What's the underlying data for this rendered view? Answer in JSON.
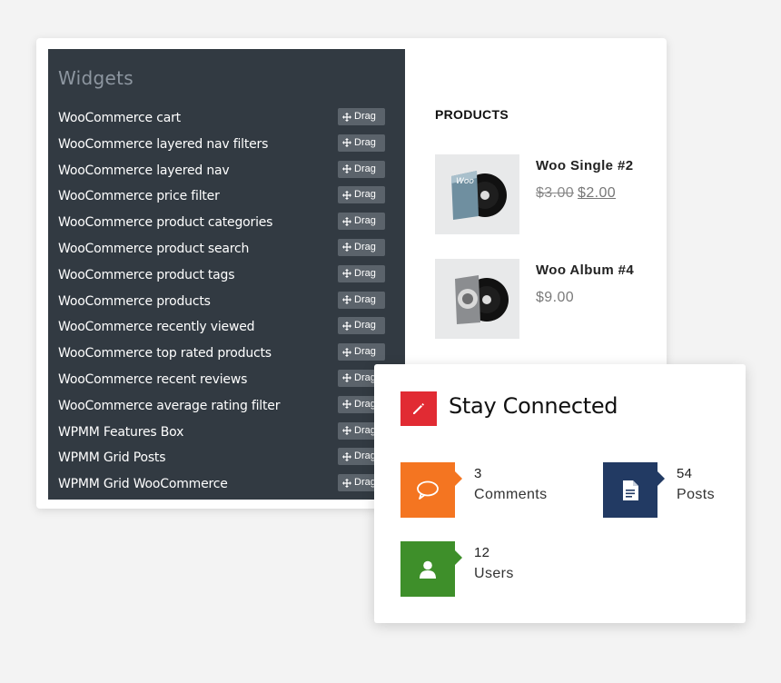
{
  "widgets": {
    "title": "Widgets",
    "drag_label": "Drag",
    "items": [
      "WooCommerce cart",
      "WooCommerce layered nav filters",
      "WooCommerce layered nav",
      "WooCommerce price filter",
      "WooCommerce product categories",
      "WooCommerce product search",
      "WooCommerce product tags",
      "WooCommerce products",
      "WooCommerce recently viewed",
      "WooCommerce top rated products",
      "WooCommerce recent reviews",
      "WooCommerce average rating filter",
      "WPMM Features Box",
      "WPMM Grid Posts",
      "WPMM Grid WooCommerce"
    ]
  },
  "products": {
    "title": "PRODUCTS",
    "items": [
      {
        "name": "Woo Single #2",
        "old_price": "$3.00",
        "price": "$2.00",
        "cover_text": "Woo"
      },
      {
        "name": "Woo Album #4",
        "old_price": "",
        "price": "$9.00",
        "cover_text": ""
      }
    ]
  },
  "stay_connected": {
    "title": "Stay Connected",
    "stats": [
      {
        "count": "3",
        "label": "Comments",
        "color": "#f47521",
        "icon": "comment-icon"
      },
      {
        "count": "54",
        "label": "Posts",
        "color": "#223a63",
        "icon": "document-icon"
      },
      {
        "count": "12",
        "label": "Users",
        "color": "#3e8f2a",
        "icon": "user-icon"
      }
    ],
    "icon_color": "#e12b33"
  }
}
